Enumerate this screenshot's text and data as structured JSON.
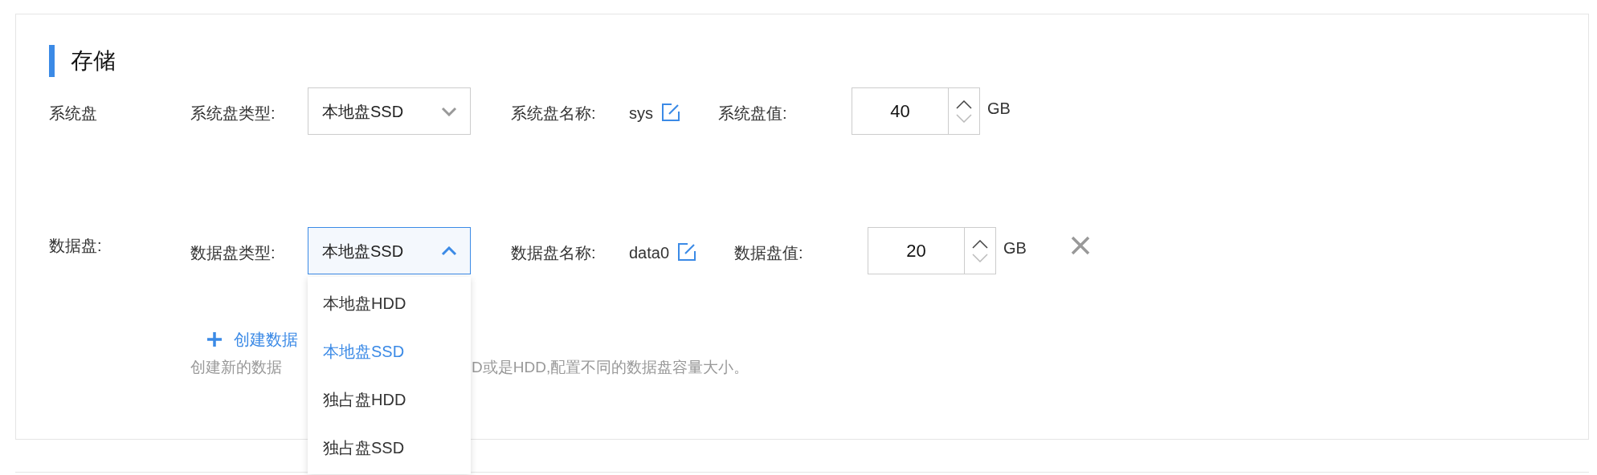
{
  "section": {
    "title": "存储"
  },
  "disks": [
    {
      "label": "系统盘",
      "type_label": "系统盘类型:",
      "type_value": "本地盘SSD",
      "expanded": false,
      "name_label": "系统盘名称:",
      "name_value": "sys",
      "size_label": "系统盘值:",
      "size_value": "40",
      "unit": "GB",
      "removable": false
    },
    {
      "label": "数据盘:",
      "type_label": "数据盘类型:",
      "type_value": "本地盘SSD",
      "expanded": true,
      "name_label": "数据盘名称:",
      "name_value": "data0",
      "size_label": "数据盘值:",
      "size_value": "20",
      "unit": "GB",
      "removable": true,
      "options": [
        {
          "label": "本地盘HDD",
          "selected": false
        },
        {
          "label": "本地盘SSD",
          "selected": true
        },
        {
          "label": "独占盘HDD",
          "selected": false
        },
        {
          "label": "独占盘SSD",
          "selected": false
        }
      ]
    }
  ],
  "add_data_disk": {
    "label": "创建数据"
  },
  "hint": [
    "创建新的数据",
    "D或是HDD,配置不同的数据盘容量大小。"
  ]
}
